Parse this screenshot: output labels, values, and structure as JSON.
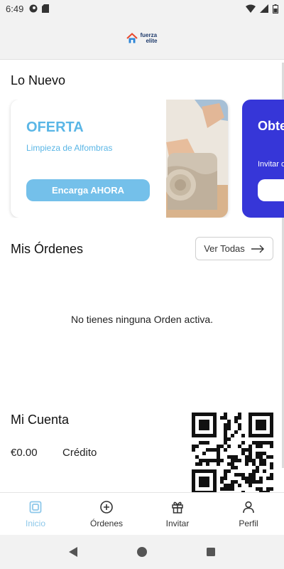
{
  "status_bar": {
    "time": "6:49"
  },
  "header": {
    "logo_line1": "fuerza",
    "logo_line2": "elite"
  },
  "new_section": {
    "title": "Lo Nuevo",
    "promo": {
      "title": "OFERTA",
      "subtitle": "Limpieza de Alfombras",
      "button_label": "Encarga AHORA"
    },
    "promo2": {
      "title": "Obte Grat",
      "subtitle": "Invitar obtene"
    }
  },
  "orders": {
    "title": "Mis Órdenes",
    "view_all_label": "Ver Todas",
    "empty_message": "No tienes ninguna Orden activa."
  },
  "account": {
    "title": "Mi Cuenta",
    "balance": "€0.00",
    "credit_label": "Crédito"
  },
  "bottom_nav": {
    "items": [
      {
        "label": "Inicio",
        "icon": "home-icon",
        "active": true
      },
      {
        "label": "Órdenes",
        "icon": "plus-circle-icon",
        "active": false
      },
      {
        "label": "Invitar",
        "icon": "gift-icon",
        "active": false
      },
      {
        "label": "Perfil",
        "icon": "person-icon",
        "active": false
      }
    ]
  },
  "colors": {
    "accent": "#5ab6e6",
    "promo2_bg": "#3636d8",
    "active_nav": "#8dc8ea"
  }
}
